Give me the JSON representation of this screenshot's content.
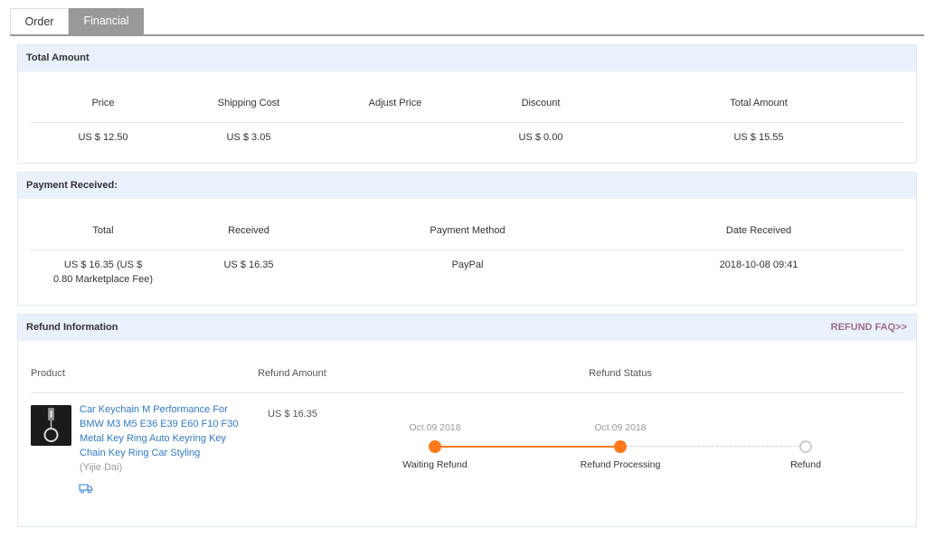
{
  "tabs": [
    {
      "label": "Order",
      "active": false
    },
    {
      "label": "Financial",
      "active": true
    }
  ],
  "total_amount": {
    "title": "Total Amount",
    "headers": [
      "Price",
      "Shipping Cost",
      "Adjust Price",
      "Discount",
      "Total Amount"
    ],
    "values": [
      "US $ 12.50",
      "US $ 3.05",
      "",
      "US $ 0.00",
      "US $ 15.55"
    ]
  },
  "payment": {
    "title": "Payment Received:",
    "headers": [
      "Total",
      "Received",
      "Payment Method",
      "Date Received"
    ],
    "total_line1": "US $ 16.35 (US $",
    "total_line2": "0.80 Marketplace Fee)",
    "received": "US $ 16.35",
    "method": "PayPal",
    "date": "2018-10-08 09:41"
  },
  "refund": {
    "title": "Refund Information",
    "faq_link": "REFUND FAQ>>",
    "headers": [
      "Product",
      "Refund Amount",
      "Refund Status"
    ],
    "product_title": "Car Keychain M Performance For BMW M3 M5 E36 E39 E60 F10 F30 Metal Key Ring Auto Keyring Key Chain Key Ring Car Styling",
    "seller": "(Yijie Dai)",
    "amount": "US $ 16.35",
    "steps": [
      {
        "label": "Waiting Refund",
        "date": "Oct.09 2018",
        "done": true
      },
      {
        "label": "Refund Processing",
        "date": "Oct.09 2018",
        "done": true
      },
      {
        "label": "Refund",
        "date": "",
        "done": false
      }
    ]
  },
  "colors": {
    "accent": "#ff7a1a",
    "link": "#2f7ac9",
    "faq": "#a06c8c",
    "header_bg": "#e9f1fc"
  },
  "icons": [
    "truck-icon"
  ]
}
